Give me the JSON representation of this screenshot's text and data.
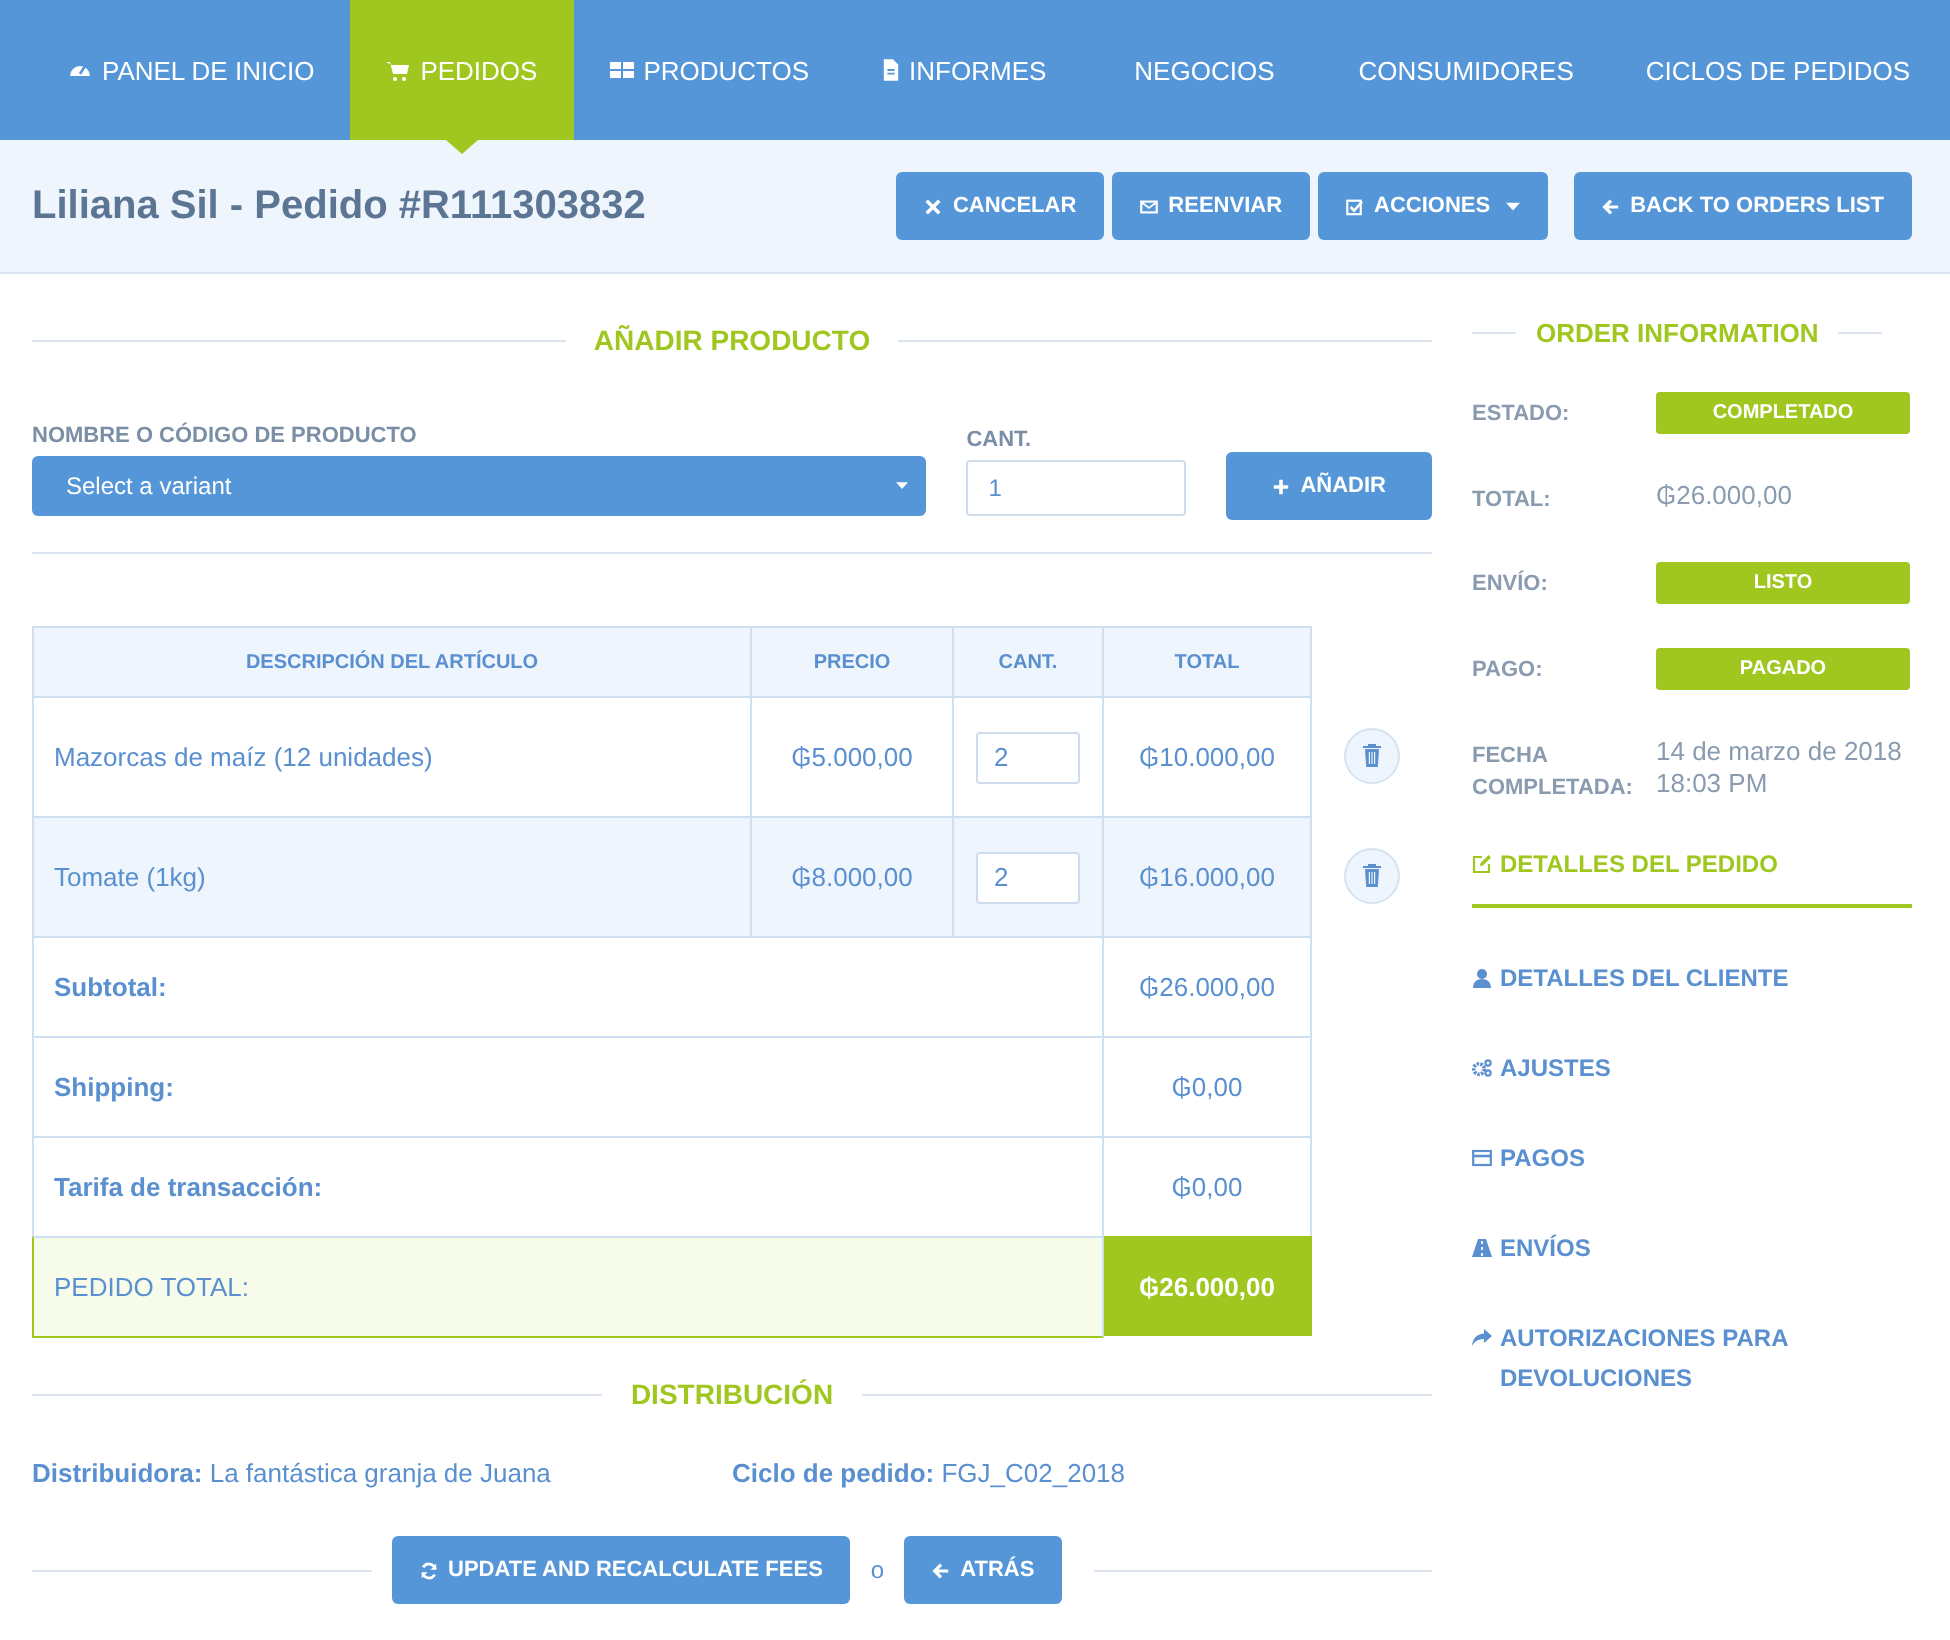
{
  "nav": {
    "items": [
      {
        "label": "PANEL DE INICIO",
        "selected": false
      },
      {
        "label": "PEDIDOS",
        "selected": true
      },
      {
        "label": "PRODUCTOS",
        "selected": false
      },
      {
        "label": "INFORMES",
        "selected": false
      },
      {
        "label": "NEGOCIOS",
        "selected": false
      },
      {
        "label": "CONSUMIDORES",
        "selected": false
      },
      {
        "label": "CICLOS DE PEDIDOS",
        "selected": false
      }
    ]
  },
  "header": {
    "title": "Liliana Sil - Pedido #R111303832",
    "buttons": [
      {
        "label": "CANCELAR"
      },
      {
        "label": "REENVIAR"
      },
      {
        "label": "ACCIONES"
      },
      {
        "label": "BACK TO ORDERS LIST"
      }
    ]
  },
  "add_product": {
    "heading": "AÑADIR PRODUCTO",
    "product_label": "NOMBRE O CÓDIGO DE PRODUCTO",
    "product_value": "Select a variant",
    "qty_label": "CANT.",
    "qty_value": "1",
    "add_button": "AÑADIR"
  },
  "table": {
    "columns": [
      "DESCRIPCIÓN DEL ARTÍCULO",
      "PRECIO",
      "CANT.",
      "TOTAL"
    ],
    "rows": [
      {
        "description": "Mazorcas de maíz (12 unidades)",
        "price": "₲5.000,00",
        "qty": "2",
        "total": "₲10.000,00"
      },
      {
        "description": "Tomate (1kg)",
        "price": "₲8.000,00",
        "qty": "2",
        "total": "₲16.000,00"
      }
    ],
    "summary": [
      {
        "label": "Subtotal:",
        "value": "₲26.000,00",
        "kind": "line"
      },
      {
        "label": "Shipping:",
        "value": "₲0,00",
        "kind": "line"
      },
      {
        "label": "Tarifa de transacción:",
        "value": "₲0,00",
        "kind": "line"
      },
      {
        "label": "PEDIDO TOTAL:",
        "value": "₲26.000,00",
        "kind": "grand"
      }
    ]
  },
  "distribution": {
    "heading": "DISTRIBUCIÓN",
    "fields": [
      {
        "label": "Distribuidora:",
        "value": "La fantástica granja de Juana"
      },
      {
        "label": "Ciclo de pedido:",
        "value": "FGJ_C02_2018"
      }
    ]
  },
  "footer": {
    "primary_button": "UPDATE AND RECALCULATE FEES",
    "separator": "o",
    "back_button": "ATRÁS"
  },
  "sidebar": {
    "heading": "ORDER INFORMATION",
    "info": [
      {
        "label": "ESTADO:",
        "value": "COMPLETADO",
        "kind": "badge"
      },
      {
        "label": "TOTAL:",
        "value": "₲26.000,00",
        "kind": "text"
      },
      {
        "label": "ENVÍO:",
        "value": "LISTO",
        "kind": "badge"
      },
      {
        "label": "PAGO:",
        "value": "PAGADO",
        "kind": "badge"
      },
      {
        "label": "FECHA COMPLETADA:",
        "value": "14 de marzo de 2018 18:03 PM",
        "kind": "text"
      }
    ],
    "links": [
      {
        "label": "DETALLES DEL PEDIDO",
        "selected": true
      },
      {
        "label": "DETALLES DEL CLIENTE",
        "selected": false
      },
      {
        "label": "AJUSTES",
        "selected": false
      },
      {
        "label": "PAGOS",
        "selected": false
      },
      {
        "label": "ENVÍOS",
        "selected": false
      },
      {
        "label": "AUTORIZACIONES PARA DEVOLUCIONES",
        "selected": false
      }
    ]
  }
}
